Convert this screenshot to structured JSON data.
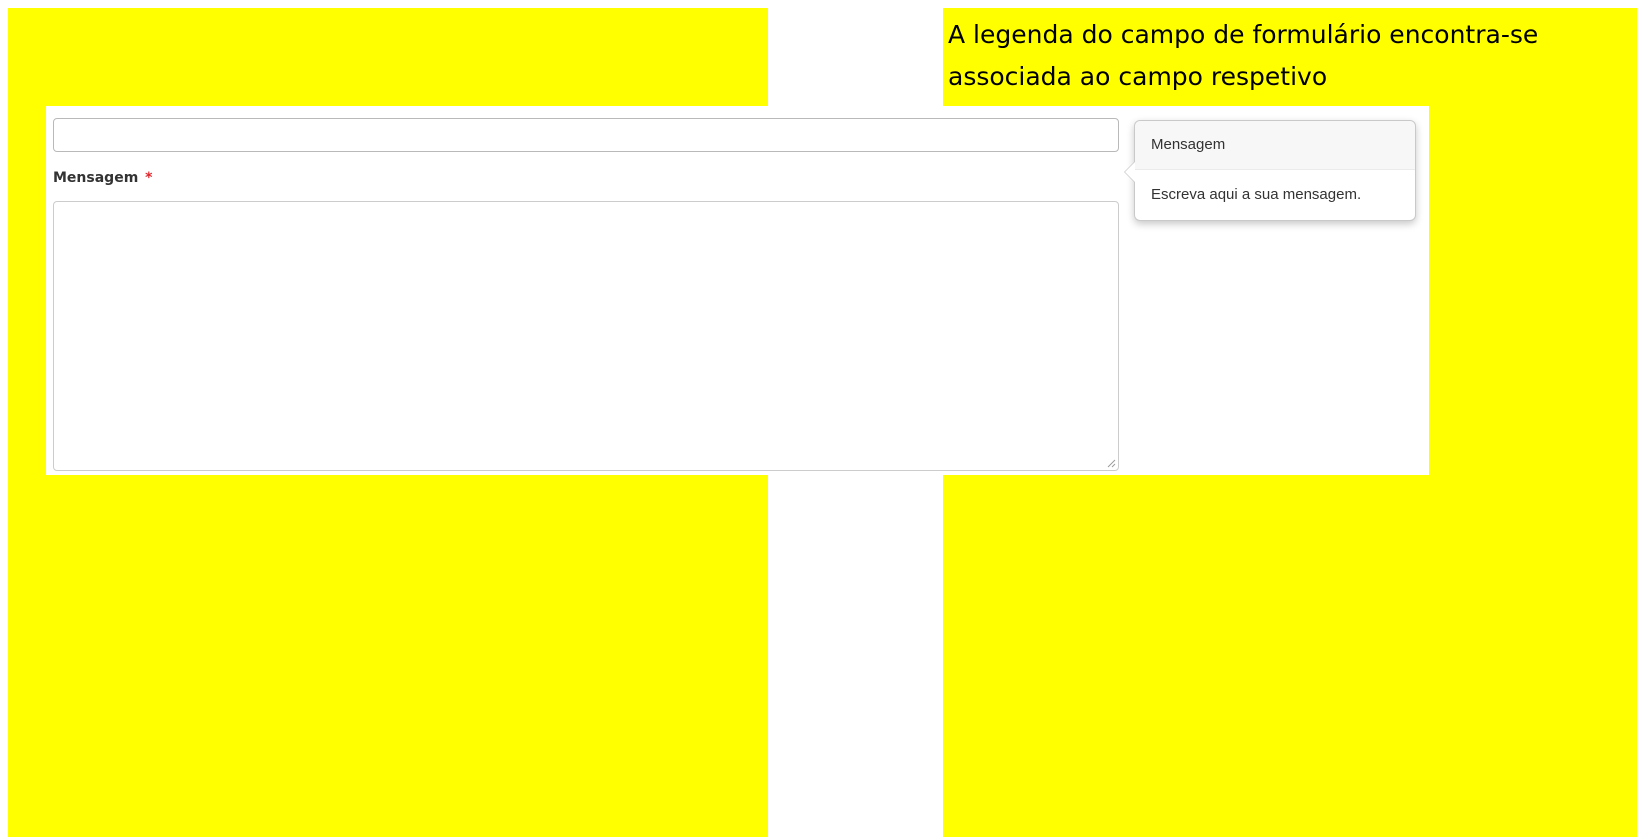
{
  "caption": {
    "text": "A legenda do campo de formulário encontra-se associada ao campo respetivo"
  },
  "form": {
    "text_input": {
      "value": "",
      "placeholder": ""
    },
    "message_label": "Mensagem",
    "required_mark": "*",
    "message_textarea": {
      "value": "",
      "placeholder": ""
    }
  },
  "popover": {
    "title": "Mensagem",
    "content": "Escreva aqui a sua mensagem."
  },
  "colors": {
    "highlight": "#ffff00",
    "required": "#e0262b",
    "label_text": "#333333",
    "input_border": "#b9b9b9"
  }
}
